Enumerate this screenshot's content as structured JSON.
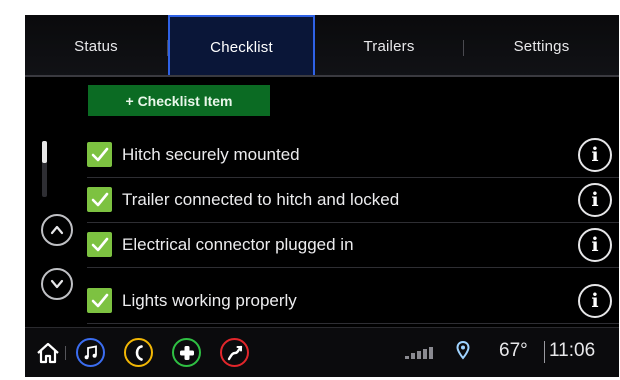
{
  "tabs": [
    {
      "label": "Status",
      "active": false
    },
    {
      "label": "Checklist",
      "active": true
    },
    {
      "label": "Trailers",
      "active": false
    },
    {
      "label": "Settings",
      "active": false
    }
  ],
  "add_button": {
    "label": "+ Checklist Item"
  },
  "checklist": [
    {
      "label": "Hitch securely mounted",
      "checked": true
    },
    {
      "label": "Trailer connected to hitch and locked",
      "checked": true
    },
    {
      "label": "Electrical connector plugged in",
      "checked": true
    },
    {
      "label": "Lights working properly",
      "checked": true
    }
  ],
  "status_bar": {
    "temperature": "67°",
    "time": "11:06"
  },
  "bottom_icons": [
    {
      "name": "home-icon",
      "color": "#ffffff"
    },
    {
      "name": "music-icon",
      "color": "#3b6df0"
    },
    {
      "name": "phone-icon",
      "color": "#f2b705"
    },
    {
      "name": "apps-icon",
      "color": "#2fc043"
    },
    {
      "name": "navigation-icon",
      "color": "#e2262b"
    }
  ],
  "colors": {
    "active_tab": "#2f62e6",
    "add_button": "#0b6b23",
    "checkbox": "#7dc241"
  }
}
